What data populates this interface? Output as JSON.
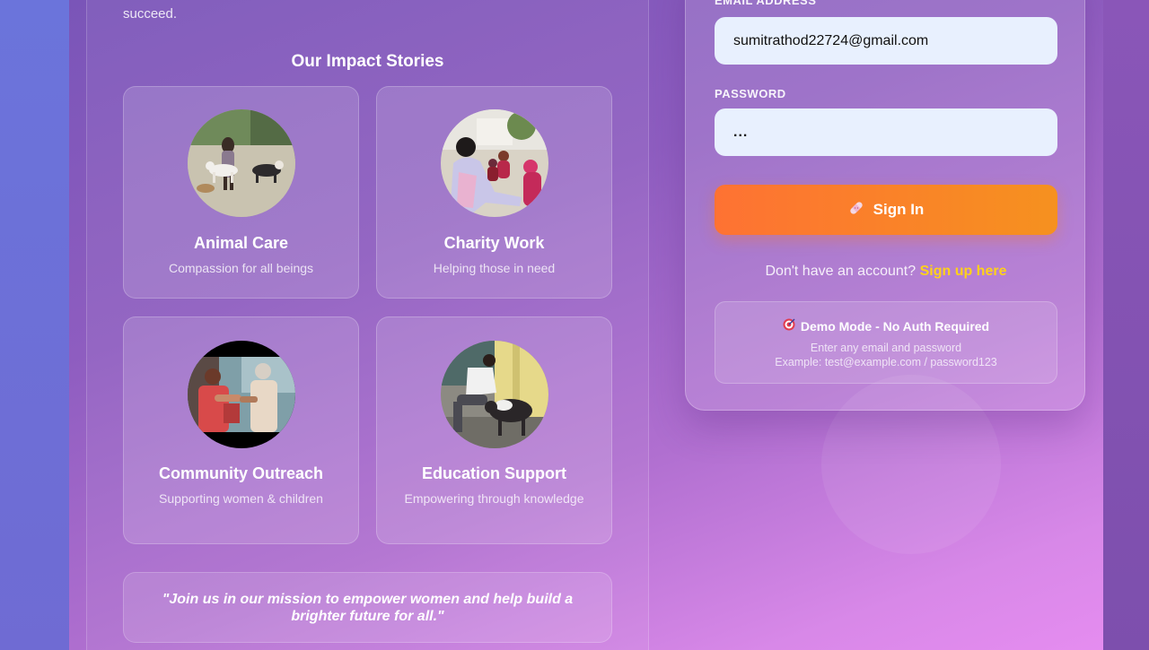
{
  "intro": {
    "tail_text": "succeed."
  },
  "stories": {
    "title": "Our Impact Stories",
    "cards": [
      {
        "title": "Animal Care",
        "desc": "Compassion for all beings",
        "photo": "dogs-street-photo"
      },
      {
        "title": "Charity Work",
        "desc": "Helping those in need",
        "photo": "women-gathering-photo"
      },
      {
        "title": "Community Outreach",
        "desc": "Supporting women & children",
        "photo": "elder-women-photo"
      },
      {
        "title": "Education Support",
        "desc": "Empowering through knowledge",
        "photo": "feeding-cow-photo"
      }
    ]
  },
  "quote": {
    "text": "\"Join us in our mission to empower women and help build a brighter future for all.\""
  },
  "login": {
    "email_label": "EMAIL ADDRESS",
    "email_value": "sumitrathod22724@gmail.com",
    "password_label": "PASSWORD",
    "password_value": "...",
    "signin_label": "Sign In",
    "signin_icon": "bandage-icon",
    "signup_prompt": "Don't have an account?",
    "signup_link": "Sign up here"
  },
  "demo": {
    "icon": "target-icon",
    "title": "Demo Mode - No Auth Required",
    "line1": "Enter any email and password",
    "line2": "Example: test@example.com / password123"
  },
  "colors": {
    "accent_orange": "#fe7233",
    "accent_orange_end": "#f6911f",
    "link_yellow": "#ffd11a",
    "input_bg": "#e8f0fe"
  }
}
